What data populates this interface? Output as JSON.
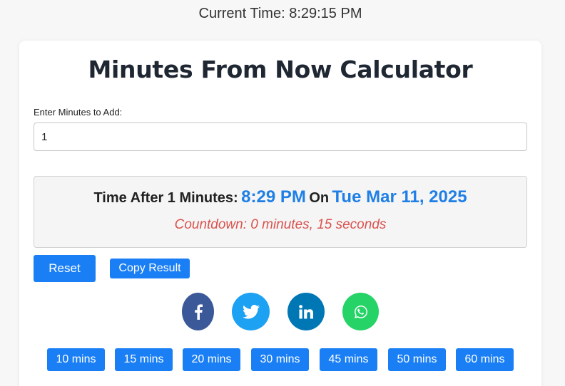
{
  "header": {
    "current_time": "Current Time: 8:29:15 PM"
  },
  "calculator": {
    "title": "Minutes From Now Calculator",
    "input_label": "Enter Minutes to Add:",
    "input_value": "1"
  },
  "result": {
    "prefix": "Time After 1 Minutes:",
    "time": "8:29 PM",
    "on_label": "On",
    "date": "Tue Mar 11, 2025",
    "countdown": "Countdown: 0 minutes, 15 seconds"
  },
  "actions": {
    "reset_label": "Reset",
    "copy_label": "Copy Result"
  },
  "share": [
    {
      "icon": "facebook-icon",
      "color": "#3b5998"
    },
    {
      "icon": "twitter-icon",
      "color": "#1da1f2"
    },
    {
      "icon": "linkedin-icon",
      "color": "#0077b5"
    },
    {
      "icon": "whatsapp-icon",
      "color": "#25d366"
    }
  ],
  "presets": [
    "10 mins",
    "15 mins",
    "20 mins",
    "30 mins",
    "45 mins",
    "50 mins",
    "60 mins"
  ],
  "colors": {
    "accent": "#1a7ff5",
    "result_highlight": "#1f7fe6",
    "countdown": "#d9534f"
  }
}
